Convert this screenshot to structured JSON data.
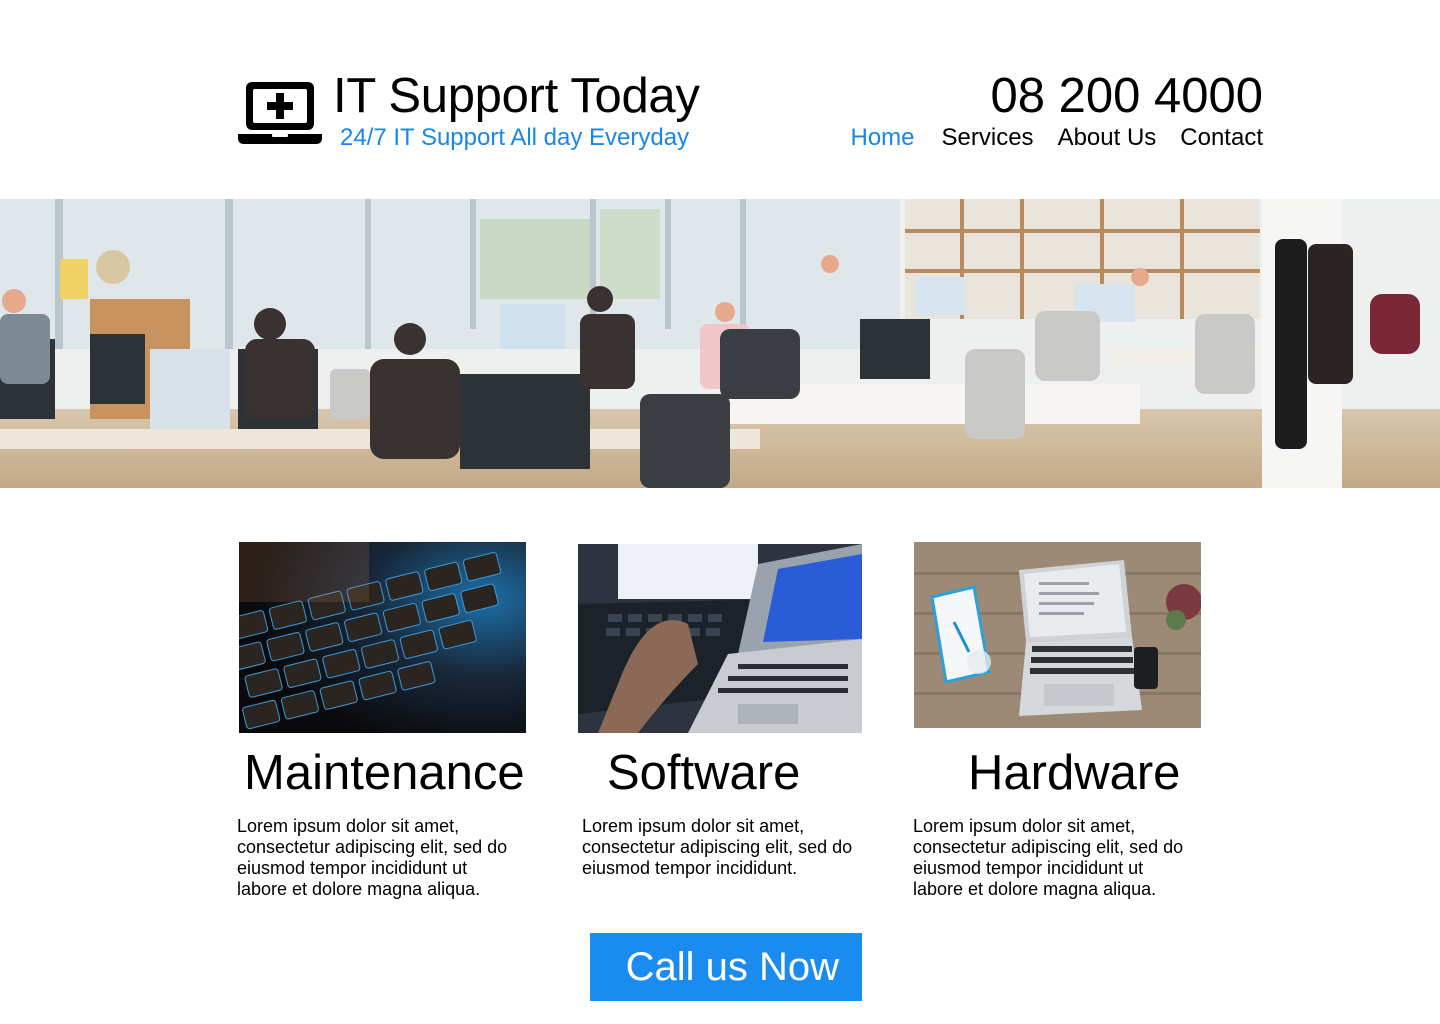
{
  "header": {
    "logo_icon": "laptop-medical-icon",
    "title": "IT Support Today",
    "tagline": "24/7 IT Support All day Everyday",
    "phone": "08 200 4000",
    "nav": [
      {
        "label": "Home",
        "active": true
      },
      {
        "label": "Services",
        "active": false
      },
      {
        "label": "About Us",
        "active": false
      },
      {
        "label": "Contact",
        "active": false
      }
    ]
  },
  "hero": {
    "image": "open-plan-office-photo"
  },
  "services": [
    {
      "image": "backlit-keyboard-photo",
      "title": "Maintenance",
      "text": "Lorem ipsum dolor sit amet, consectetur adipiscing elit, sed do eiusmod tempor incididunt ut labore et dolore magna aliqua."
    },
    {
      "image": "hands-typing-laptops-photo",
      "title": "Software",
      "text": "Lorem ipsum dolor sit amet, consectetur adipiscing elit, sed do eiusmod tempor incididunt."
    },
    {
      "image": "laptop-on-desk-photo",
      "title": "Hardware",
      "text": "Lorem ipsum dolor sit amet, consectetur adipiscing elit, sed do eiusmod tempor incididunt ut labore et dolore magna aliqua."
    }
  ],
  "cta": {
    "label": "Call us Now"
  },
  "colors": {
    "accent": "#1a86e8",
    "button": "#1a8cf0",
    "text": "#000000",
    "background": "#ffffff"
  }
}
